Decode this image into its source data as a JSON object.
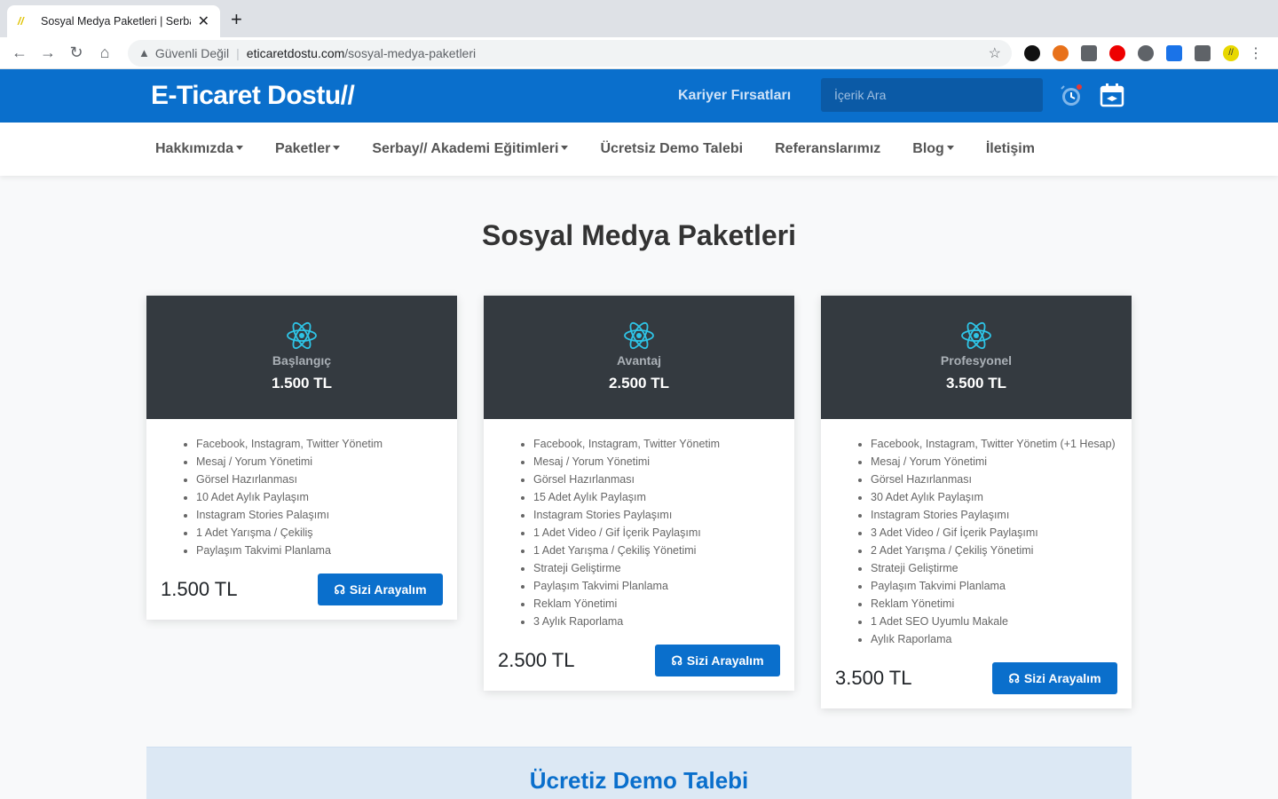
{
  "browser": {
    "tab_title": "Sosyal Medya Paketleri | Serbay",
    "security_label": "Güvenli Değil",
    "url_host": "eticaretdostu.com",
    "url_path": "/sosyal-medya-paketleri"
  },
  "header": {
    "logo": "E-Ticaret Dostu//",
    "career_link": "Kariyer Fırsatları",
    "search_placeholder": "İçerik Ara"
  },
  "nav": {
    "items": [
      {
        "label": "Hakkımızda",
        "dropdown": true
      },
      {
        "label": "Paketler",
        "dropdown": true
      },
      {
        "label": "Serbay// Akademi Eğitimleri",
        "dropdown": true
      },
      {
        "label": "Ücretsiz Demo Talebi",
        "dropdown": false
      },
      {
        "label": "Referanslarımız",
        "dropdown": false
      },
      {
        "label": "Blog",
        "dropdown": true
      },
      {
        "label": "İletişim",
        "dropdown": false
      }
    ]
  },
  "page": {
    "title": "Sosyal Medya Paketleri"
  },
  "plans": [
    {
      "name": "Başlangıç",
      "price": "1.500 TL",
      "features": [
        "Facebook, Instagram, Twitter Yönetim",
        "Mesaj / Yorum Yönetimi",
        "Görsel Hazırlanması",
        "10 Adet Aylık Paylaşım",
        "Instagram Stories Palaşımı",
        "1 Adet Yarışma / Çekiliş",
        "Paylaşım Takvimi Planlama"
      ],
      "button": "Sizi Arayalım"
    },
    {
      "name": "Avantaj",
      "price": "2.500 TL",
      "features": [
        "Facebook, Instagram, Twitter Yönetim",
        "Mesaj / Yorum Yönetimi",
        "Görsel Hazırlanması",
        "15 Adet Aylık Paylaşım",
        "Instagram Stories Paylaşımı",
        "1 Adet Video / Gif İçerik Paylaşımı",
        "1 Adet Yarışma / Çekiliş Yönetimi",
        "Strateji Geliştirme",
        "Paylaşım Takvimi Planlama",
        "Reklam Yönetimi",
        "3 Aylık Raporlama"
      ],
      "button": "Sizi Arayalım"
    },
    {
      "name": "Profesyonel",
      "price": "3.500 TL",
      "features": [
        "Facebook, Instagram, Twitter Yönetim (+1 Hesap)",
        "Mesaj / Yorum Yönetimi",
        "Görsel Hazırlanması",
        "30 Adet Aylık Paylaşım",
        "Instagram Stories Paylaşımı",
        "3 Adet Video / Gif İçerik Paylaşımı",
        "2 Adet Yarışma / Çekiliş Yönetimi",
        "Strateji Geliştirme",
        "Paylaşım Takvimi Planlama",
        "Reklam Yönetimi",
        "1 Adet SEO Uyumlu Makale",
        "Aylık Raporlama"
      ],
      "button": "Sizi Arayalım"
    }
  ],
  "demo": {
    "title": "Ücretiz Demo Talebi"
  },
  "colors": {
    "brand": "#0a6fcc",
    "card_header": "#343a40"
  }
}
